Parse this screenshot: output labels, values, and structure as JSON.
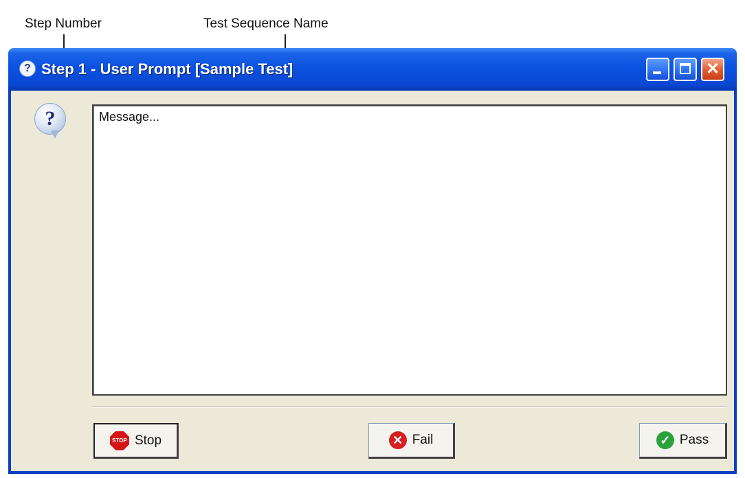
{
  "annotations": {
    "step_number": "Step Number",
    "test_sequence_name": "Test Sequence Name"
  },
  "window": {
    "title": "Step 1 - User Prompt [Sample Test]",
    "title_icon": "question-icon",
    "controls": {
      "close_glyph": "✕"
    }
  },
  "prompt": {
    "icon": "question-bubble-icon",
    "icon_glyph": "?",
    "message": "Message..."
  },
  "buttons": {
    "stop": {
      "label": "Stop",
      "icon": "stop-sign-icon",
      "icon_text": "STOP"
    },
    "fail": {
      "label": "Fail",
      "icon": "red-x-icon",
      "icon_glyph": "✕"
    },
    "pass": {
      "label": "Pass",
      "icon": "green-check-icon",
      "icon_glyph": "✓"
    }
  },
  "colors": {
    "titlebar": "#0a52e0",
    "client_bg": "#ece9d8",
    "close_button": "#e15a2f",
    "stop_red": "#d41414",
    "pass_green": "#2aa33a"
  }
}
